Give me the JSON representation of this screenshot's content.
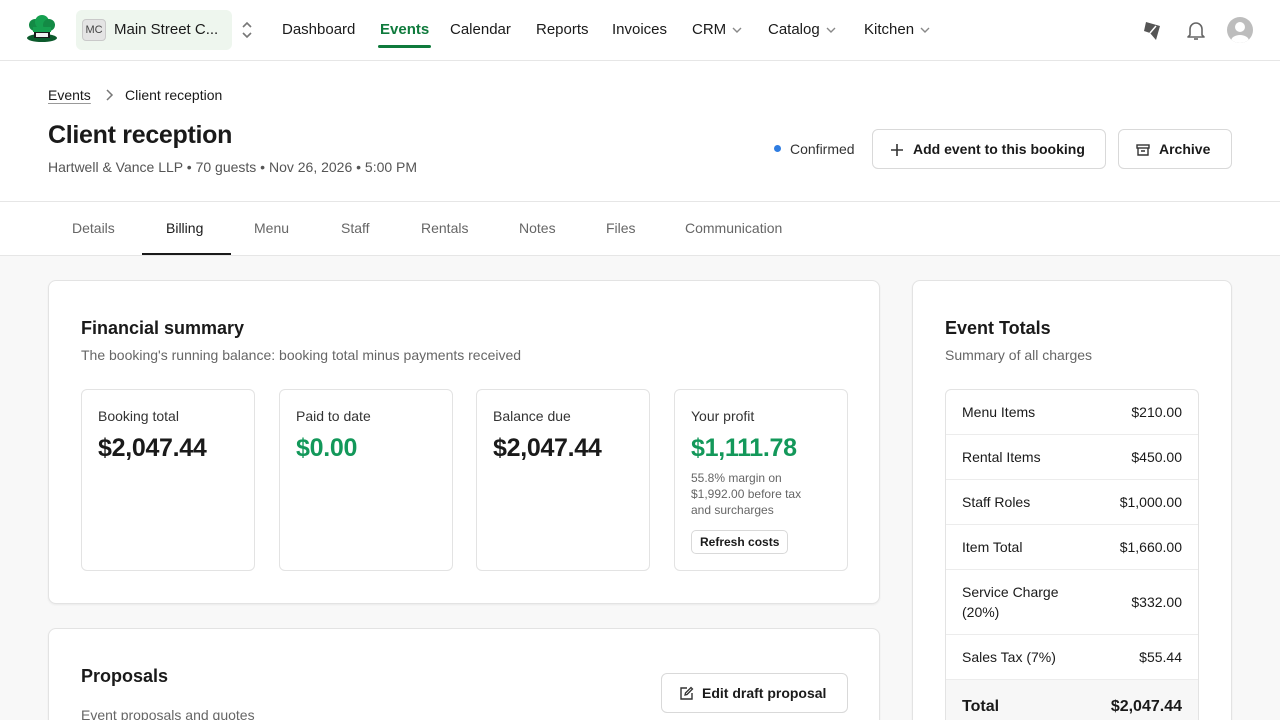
{
  "org": {
    "badge": "MC",
    "name": "Main Street C..."
  },
  "nav": {
    "items": [
      {
        "label": "Dashboard"
      },
      {
        "label": "Events",
        "active": true
      },
      {
        "label": "Calendar"
      },
      {
        "label": "Reports"
      },
      {
        "label": "Invoices"
      },
      {
        "label": "CRM",
        "dropdown": true
      },
      {
        "label": "Catalog",
        "dropdown": true
      },
      {
        "label": "Kitchen",
        "dropdown": true
      }
    ]
  },
  "icons": {
    "logo": "chef-hat-logo-icon",
    "org_switch": "chevron-up-down-icon",
    "feature": "megaphone-icon",
    "notifications": "bell-icon",
    "avatar": "user-avatar-icon"
  },
  "colors": {
    "brand": "#0f7a3c",
    "profit": "#13985a",
    "status_dot": "#2f7de1"
  },
  "breadcrumb": {
    "parent": "Events",
    "current": "Client reception"
  },
  "event": {
    "title": "Client reception",
    "subtitle": "Hartwell & Vance LLP • 70 guests • Nov 26, 2026 • 5:00 PM",
    "status": "Confirmed"
  },
  "actions": {
    "add_event": "Add event to this booking",
    "archive": "Archive"
  },
  "tabs": [
    {
      "label": "Details"
    },
    {
      "label": "Billing",
      "active": true
    },
    {
      "label": "Menu"
    },
    {
      "label": "Staff"
    },
    {
      "label": "Rentals"
    },
    {
      "label": "Notes"
    },
    {
      "label": "Files"
    },
    {
      "label": "Communication"
    }
  ],
  "financial_summary": {
    "title": "Financial summary",
    "description": "The booking's running balance: booking total minus payments received",
    "booking_total": {
      "label": "Booking total",
      "value": "$2,047.44"
    },
    "paid_to_date": {
      "label": "Paid to date",
      "value": "$0.00"
    },
    "balance_due": {
      "label": "Balance due",
      "value": "$2,047.44"
    },
    "profit": {
      "label": "Your profit",
      "value": "$1,111.78",
      "note": "55.8% margin on $1,992.00 before tax and surcharges",
      "refresh_label": "Refresh costs"
    }
  },
  "proposals": {
    "title": "Proposals",
    "description": "Event proposals and quotes",
    "edit_label": "Edit draft proposal"
  },
  "event_totals": {
    "title": "Event Totals",
    "description": "Summary of all charges",
    "rows": [
      {
        "label": "Menu Items",
        "value": "$210.00"
      },
      {
        "label": "Rental Items",
        "value": "$450.00"
      },
      {
        "label": "Staff Roles",
        "value": "$1,000.00"
      },
      {
        "label": "Item Total",
        "value": "$1,660.00"
      },
      {
        "label": "Service Charge (20%)",
        "value": "$332.00"
      },
      {
        "label": "Sales Tax (7%)",
        "value": "$55.44"
      },
      {
        "label": "Total",
        "value": "$2,047.44"
      }
    ]
  }
}
